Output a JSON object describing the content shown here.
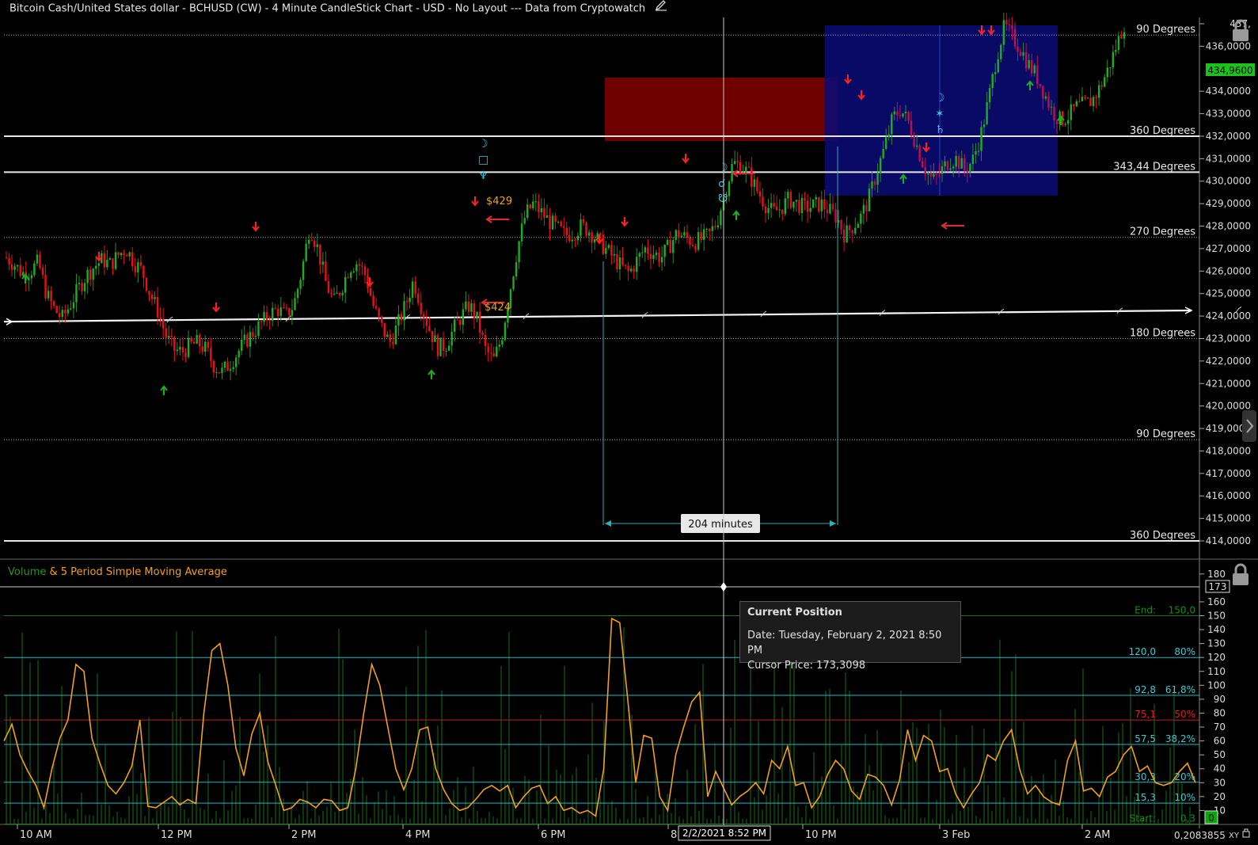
{
  "title": "Bitcoin Cash/United States dollar - BCHUSD (CW) - 4 Minute CandleStick Chart - USD - No Layout --- Data from Cryptowatch",
  "colors": {
    "background": "#000000",
    "up": "#1fae1f",
    "down": "#e8111a",
    "volume_line": "#f0a020",
    "fib_line": "#1fb8c0",
    "half_line": "#c0201f",
    "current_price_bg": "#18c418"
  },
  "icons": [
    "edit-pencil-icon",
    "lock-icon",
    "lock-icon",
    "cursor-crosshair-icon",
    "scroll-right-chevron-icon",
    "zero-toggle-icon",
    "xy-toggle-icon",
    "lock-small-icon"
  ],
  "chart_data": [
    {
      "type": "candlestick",
      "name": "price",
      "ylim": [
        413.5,
        437.3
      ],
      "y_ticks": [
        "437,",
        "436,0000",
        "434,9600",
        "434,0000",
        "433,0000",
        "432,0000",
        "431,0000",
        "430,0000",
        "429,0000",
        "428,0000",
        "427,0000",
        "426,0000",
        "425,0000",
        "424,0000",
        "423,0000",
        "422,0000",
        "421,0000",
        "420,0000",
        "419,0000",
        "418,0000",
        "417,0000",
        "416,0000",
        "415,0000",
        "414,0000"
      ],
      "x_ticks": [
        "10 AM",
        "12 PM",
        "2 PM",
        "4 PM",
        "6 PM",
        "8 P",
        "10 PM",
        "3 Feb",
        "2 AM"
      ],
      "current_price": "434,9600",
      "close_series": [
        426.6,
        426.3,
        425.9,
        426.0,
        426.4,
        425.0,
        424.3,
        423.9,
        424.5,
        425.2,
        425.8,
        426.2,
        426.5,
        426.3,
        426.7,
        427.0,
        426.4,
        426.0,
        425.0,
        424.2,
        423.1,
        422.5,
        422.4,
        422.7,
        422.8,
        422.5,
        421.8,
        421.5,
        421.9,
        422.4,
        422.9,
        423.3,
        423.7,
        424.1,
        424.3,
        424.0,
        424.5,
        426.0,
        428.0,
        427.0,
        425.5,
        424.6,
        425.3,
        426.2,
        426.4,
        425.8,
        424.4,
        423.5,
        422.8,
        423.6,
        424.5,
        425.6,
        424.4,
        423.4,
        422.6,
        422.7,
        423.4,
        424.0,
        424.5,
        423.8,
        422.5,
        422.0,
        423.0,
        425.0,
        427.0,
        428.5,
        429.0,
        428.6,
        428.2,
        427.9,
        427.6,
        427.7,
        428.0,
        427.8,
        427.4,
        427.0,
        426.6,
        426.2,
        425.9,
        426.5,
        427.0,
        426.8,
        426.6,
        427.1,
        427.7,
        427.5,
        427.3,
        427.4,
        427.6,
        428.2,
        429.5,
        430.8,
        430.7,
        430.3,
        429.6,
        429.0,
        428.6,
        428.8,
        429.2,
        429.0,
        428.8,
        428.9,
        429.0,
        428.7,
        428.4,
        427.6,
        428.0,
        428.4,
        429.2,
        430.4,
        431.5,
        432.8,
        433.2,
        432.6,
        431.6,
        430.6,
        430.0,
        430.4,
        430.9,
        431.0,
        430.5,
        430.9,
        432.0,
        433.6,
        435.5,
        436.9,
        436.4,
        435.9,
        435.2,
        434.7,
        433.9,
        433.1,
        432.7,
        432.9,
        433.3,
        433.4,
        433.6,
        434.2,
        435.0,
        436.0,
        437.0
      ],
      "annotations": {
        "horizontal_lines": [
          {
            "label": "90 Degrees",
            "value": 436.5
          },
          {
            "label": "360 Degrees",
            "value": 432.0
          },
          {
            "label": "343,44 Degrees",
            "value": 430.4
          },
          {
            "label": "270 Degrees",
            "value": 427.5
          },
          {
            "label": "180 Degrees",
            "value": 423.0
          },
          {
            "label": "90 Degrees",
            "value": 418.5
          },
          {
            "label": "360 Degrees",
            "value": 414.0
          }
        ],
        "price_labels": [
          "$429",
          "$424"
        ],
        "time_span_label": "204 minutes",
        "planet_glyphs_1": [
          "☽",
          "□",
          "♆"
        ],
        "planet_glyphs_2": [
          "☽",
          "☌",
          "☋"
        ],
        "planet_glyphs_3": [
          "☽",
          "✶",
          "♄"
        ]
      }
    },
    {
      "type": "line",
      "name": "volume",
      "legend_volume": "Volume",
      "legend_sma": " & 5 Period Simple Moving Average",
      "ylim": [
        0,
        185
      ],
      "y_ticks": [
        "180",
        "173",
        "160",
        "150",
        "140",
        "130",
        "120",
        "110",
        "100",
        "90",
        "80",
        "70",
        "60",
        "50",
        "40",
        "30",
        "20",
        "10"
      ],
      "cursor_value_label": "173",
      "fib_levels": [
        {
          "label": "End:",
          "value_label": "150,0",
          "value": 150
        },
        {
          "label": "120,0",
          "value_label": "80%",
          "value": 120
        },
        {
          "label": "92,8",
          "value_label": "61,8%",
          "value": 92.8
        },
        {
          "label": "75,1",
          "value_label": "50%",
          "value": 75.1
        },
        {
          "label": "57,5",
          "value_label": "38,2%",
          "value": 57.5
        },
        {
          "label": "30,3",
          "value_label": "20%",
          "value": 30.3
        },
        {
          "label": "15,3",
          "value_label": "10%",
          "value": 15.3
        },
        {
          "label": "Start:",
          "value_label": "0,3",
          "value": 0.3
        }
      ],
      "sma_series": [
        60,
        72,
        50,
        38,
        28,
        12,
        40,
        62,
        75,
        115,
        110,
        62,
        44,
        28,
        22,
        30,
        42,
        75,
        13,
        12,
        16,
        20,
        14,
        18,
        15,
        80,
        125,
        130,
        100,
        55,
        35,
        65,
        80,
        45,
        28,
        10,
        12,
        18,
        16,
        12,
        18,
        17,
        10,
        12,
        40,
        80,
        115,
        100,
        70,
        40,
        25,
        40,
        68,
        70,
        40,
        25,
        15,
        10,
        12,
        18,
        25,
        28,
        24,
        28,
        12,
        20,
        26,
        28,
        15,
        20,
        10,
        12,
        8,
        10,
        6,
        40,
        148,
        145,
        90,
        30,
        64,
        62,
        20,
        10,
        50,
        70,
        88,
        95,
        20,
        38,
        26,
        14,
        20,
        24,
        30,
        22,
        46,
        40,
        56,
        28,
        30,
        12,
        20,
        36,
        46,
        40,
        24,
        18,
        36,
        34,
        28,
        14,
        32,
        68,
        46,
        64,
        60,
        38,
        40,
        22,
        12,
        22,
        30,
        50,
        46,
        60,
        68,
        40,
        22,
        28,
        20,
        16,
        14,
        46,
        60,
        24,
        26,
        20,
        34,
        38,
        50,
        56,
        38,
        42,
        30,
        28,
        30,
        38,
        44,
        30
      ]
    }
  ],
  "bottom_bar": {
    "cursor_date": "2/2/2021 8:52 PM",
    "corner_value": "0,2083855",
    "xy_label": "XY",
    "zero_toggle": "0"
  },
  "tooltip": {
    "title": "Current Position",
    "date_line": "Date: Tuesday, February 2, 2021 8:50 PM",
    "price_line": "Cursor Price: 173,3098"
  }
}
